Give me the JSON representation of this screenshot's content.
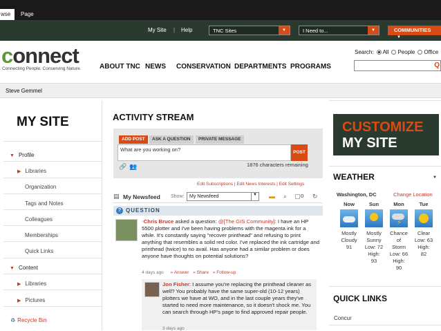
{
  "ribbon": {
    "tabs": [
      "wse",
      "Page"
    ]
  },
  "topbar": {
    "my_site": "My Site",
    "sep": "|",
    "help": "Help",
    "tnc_sites": "TNC Sites",
    "i_need_to": "I Need to...",
    "communities": "COMMUNITIES"
  },
  "header": {
    "logo": "connect",
    "tagline": "Connecting People. Conserving Nature.",
    "nav": [
      "ABOUT TNC",
      "NEWS",
      "CONSERVATION",
      "DEPARTMENTS",
      "PROGRAMS"
    ],
    "search_label": "Search:",
    "search_options": [
      "All",
      "People",
      "Office"
    ],
    "search_selected": "All"
  },
  "user": {
    "name": "Steve Gemmel"
  },
  "sidebar": {
    "title": "MY SITE",
    "profile": "Profile",
    "profile_items": [
      "Libraries",
      "Organization",
      "Tags and Notes",
      "Colleagues",
      "Memberships",
      "Quick Links"
    ],
    "content": "Content",
    "content_items": [
      "Libraries",
      "Pictures"
    ],
    "recycle": "Recycle Bin"
  },
  "activity": {
    "title": "ACTIVITY STREAM",
    "tabs": [
      "ADD POST",
      "ASK A QUESTION",
      "PRIVATE MESSAGE"
    ],
    "input_placeholder": "What are you working on?",
    "post_label": "POST",
    "chars_remaining": "1876 characters remaining",
    "edit_links": "Edit Subscriptions | Edit News Interests | Edit Settings",
    "newsfeed_title": "My Newsfeed",
    "show_label": "Show:",
    "show_value": "My Newsfeed",
    "comment_count": "0",
    "question_label": "QUESTION",
    "q_author": "Chris Bruce",
    "q_action": " asked a question: ",
    "q_group": "@[The GIS Community]",
    "q_body": ": I have an HP 5500 plotter and I've been having problems with the magenta ink for a while. It's constantly saying \"recover printhead\" and refusing to print anything that resembles a solid red color. I've replaced the ink cartridge and printhead (twice) to no avail. Has anyone had a similar problem or does anyone have thoughts on potential solutions?",
    "q_time": "4 days ago",
    "q_actions": [
      "Answer",
      "Share",
      "Follow-up"
    ],
    "r_author": "Jon Fisher",
    "r_body": ": I assume you're replacing the printhead cleaner as well? You probably have the same super-old (10-12 years) plotters we have at WO, and in the last couple years they've started to need more maintenance, so it doesn't shock me. You can search through HP's page to find approved repair people.",
    "r_time": "3 days ago"
  },
  "right": {
    "customize_1": "CUSTOMIZE",
    "customize_2": "MY SITE",
    "weather_title": "WEATHER",
    "location": "Washington, DC",
    "change_location": "Change Location",
    "days": [
      {
        "day": "Now",
        "desc": [
          "Mostly",
          "Cloudy",
          "91"
        ]
      },
      {
        "day": "Sun",
        "desc": [
          "Mostly",
          "Sunny",
          "Low: 72",
          "High:",
          "93"
        ]
      },
      {
        "day": "Mon",
        "desc": [
          "Chance",
          "of",
          "Storm",
          "Low: 66",
          "High:",
          "90"
        ]
      },
      {
        "day": "Tue",
        "desc": [
          "Clear",
          "Low: 63",
          "High:",
          "82"
        ]
      }
    ],
    "quick_links": "QUICK LINKS",
    "concur": "Concur"
  },
  "colors": {
    "accent": "#d74b16",
    "dark_green": "#2a3a2f",
    "link_red": "#c0392b"
  }
}
